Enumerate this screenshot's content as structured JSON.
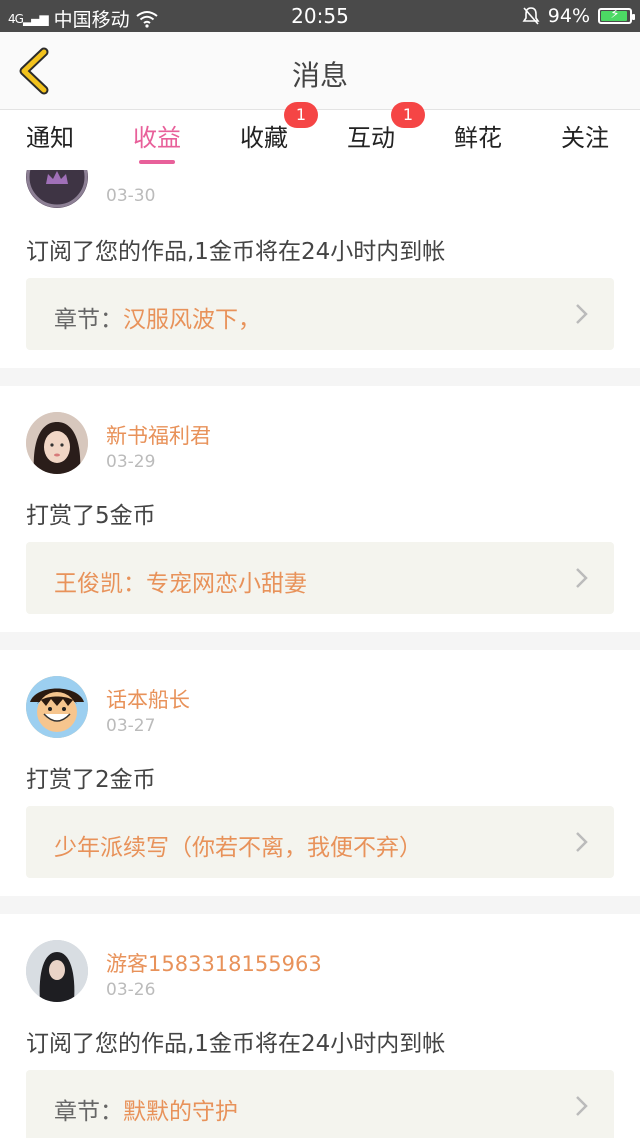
{
  "status_bar": {
    "carrier": "中国移动",
    "network": "4G",
    "time": "20:55",
    "battery": "94%",
    "battery_level": 0.94
  },
  "header": {
    "title": "消息"
  },
  "tabs": [
    {
      "label": "通知",
      "badge": ""
    },
    {
      "label": "收益",
      "badge": "",
      "active": true
    },
    {
      "label": "收藏",
      "badge": "1"
    },
    {
      "label": "互动",
      "badge": "1"
    },
    {
      "label": "鲜花",
      "badge": ""
    },
    {
      "label": "关注",
      "badge": ""
    }
  ],
  "items": [
    {
      "username": "",
      "date": "03-30",
      "message": "订阅了您的作品,1金币将在24小时内到帐",
      "ref_label": "章节：",
      "ref_value": "汉服风波下，"
    },
    {
      "username": "新书福利君",
      "date": "03-29",
      "message": "打赏了5金币",
      "ref_label": "",
      "ref_value": "王俊凯：专宠网恋小甜妻"
    },
    {
      "username": "话本船长",
      "date": "03-27",
      "message": "打赏了2金币",
      "ref_label": "",
      "ref_value": "少年派续写（你若不离，我便不弃）"
    },
    {
      "username": "游客1583318155963",
      "date": "03-26",
      "message": "订阅了您的作品,1金币将在24小时内到帐",
      "ref_label": "章节：",
      "ref_value": "默默的守护"
    }
  ],
  "colors": {
    "accent": "#e8609a",
    "name": "#e8925a",
    "badge": "#f54545",
    "back_arrow": "#f2c21d"
  }
}
